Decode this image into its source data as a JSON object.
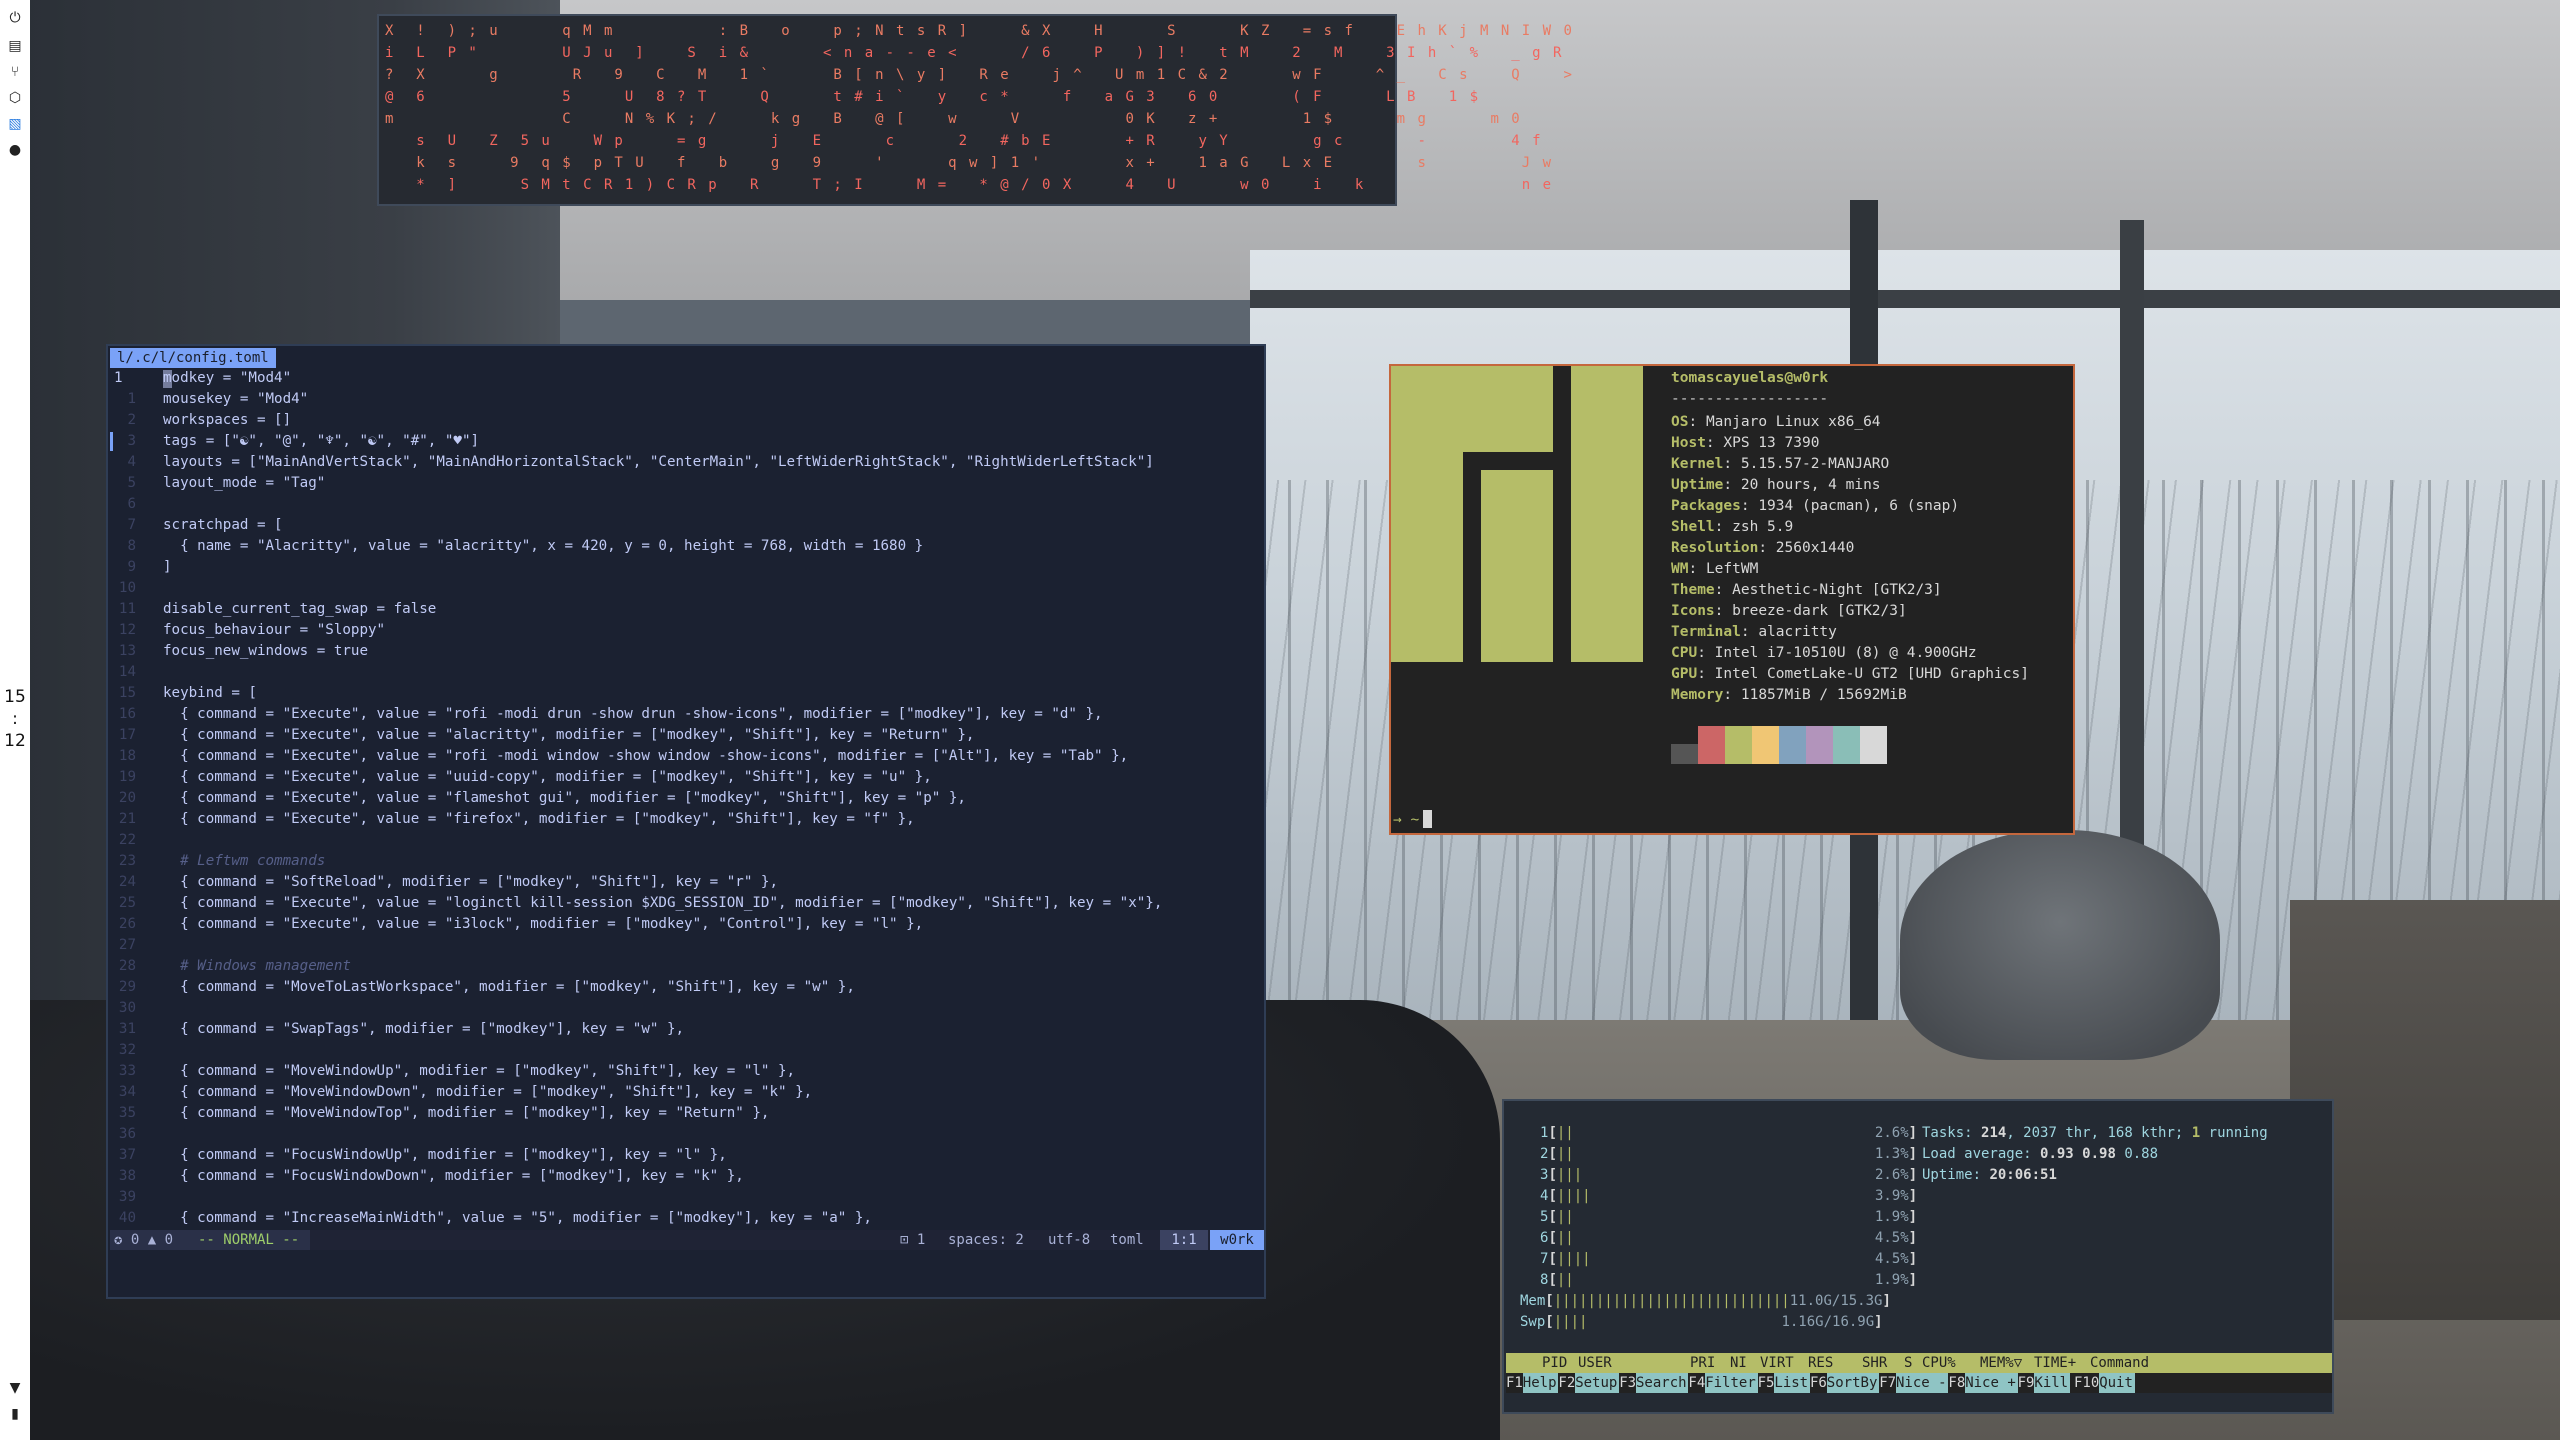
{
  "sidebar": {
    "clock_hour": "15",
    "clock_sep": ":",
    "clock_min": "12"
  },
  "matrix": {
    "lines": [
      "X  !  ) ; u      q M m          : B   o    p ; N t s R ]     & X    H      S      K Z   = s f    E h K j M N I W 0",
      "i  L  P \"        U J u  ]    S  i &       < n a - - e <      / 6    P   ) ] !   t M    2   M    3 I h ` %   _ g R",
      "?  X      g       R   9   C   M   1 `      B [ n \\ y ]   R e    j ^   U m 1 C & 2      w F     ^ _   C s    Q    >",
      "@  6             5     U  8 ? T     Q      t # i `   y   c *     f   a G 3   6 0       ( F      L B   1 $",
      "m                C     N % K ; /     k g   B   @ [    w     V          0 K   z +        1 $      m g      m 0",
      "   s  U   Z  5 u    W p     = g      j   E      c      2   # b E       + R    y Y        g c       -        4 f",
      "   k  s     9  q $  p T U   f   b    g   9     '      q w ] 1 '        x +    1 a G   L x E        s         J w",
      "   *  ]      S M t C R 1 ) C R p   R     T ; I     M =   * @ / 0 X     4   U      w 0    i   k               n e"
    ]
  },
  "editor": {
    "tab_label": "l/.c/l/config.toml",
    "lines": [
      {
        "num": "1",
        "text": "modkey = \"Mod4\"",
        "current": true
      },
      {
        "num": "1",
        "text": "mousekey = \"Mod4\""
      },
      {
        "num": "2",
        "text": "workspaces = []"
      },
      {
        "num": "3",
        "text": "tags = [\"☯\", \"@\", \"♆\", \"☯\", \"#\", \"♥\"]"
      },
      {
        "num": "4",
        "text": "layouts = [\"MainAndVertStack\", \"MainAndHorizontalStack\", \"CenterMain\", \"LeftWiderRightStack\", \"RightWiderLeftStack\"]"
      },
      {
        "num": "5",
        "text": "layout_mode = \"Tag\""
      },
      {
        "num": "6",
        "text": ""
      },
      {
        "num": "7",
        "text": "scratchpad = ["
      },
      {
        "num": "8",
        "text": "  { name = \"Alacritty\", value = \"alacritty\", x = 420, y = 0, height = 768, width = 1680 }"
      },
      {
        "num": "9",
        "text": "]"
      },
      {
        "num": "10",
        "text": ""
      },
      {
        "num": "11",
        "text": "disable_current_tag_swap = false"
      },
      {
        "num": "12",
        "text": "focus_behaviour = \"Sloppy\""
      },
      {
        "num": "13",
        "text": "focus_new_windows = true"
      },
      {
        "num": "14",
        "text": ""
      },
      {
        "num": "15",
        "text": "keybind = ["
      },
      {
        "num": "16",
        "text": "  { command = \"Execute\", value = \"rofi -modi drun -show drun -show-icons\", modifier = [\"modkey\"], key = \"d\" },"
      },
      {
        "num": "17",
        "text": "  { command = \"Execute\", value = \"alacritty\", modifier = [\"modkey\", \"Shift\"], key = \"Return\" },"
      },
      {
        "num": "18",
        "text": "  { command = \"Execute\", value = \"rofi -modi window -show window -show-icons\", modifier = [\"Alt\"], key = \"Tab\" },"
      },
      {
        "num": "19",
        "text": "  { command = \"Execute\", value = \"uuid-copy\", modifier = [\"modkey\", \"Shift\"], key = \"u\" },"
      },
      {
        "num": "20",
        "text": "  { command = \"Execute\", value = \"flameshot gui\", modifier = [\"modkey\", \"Shift\"], key = \"p\" },"
      },
      {
        "num": "21",
        "text": "  { command = \"Execute\", value = \"firefox\", modifier = [\"modkey\", \"Shift\"], key = \"f\" },"
      },
      {
        "num": "22",
        "text": ""
      },
      {
        "num": "23",
        "text": "  # Leftwm commands",
        "comment": true
      },
      {
        "num": "24",
        "text": "  { command = \"SoftReload\", modifier = [\"modkey\", \"Shift\"], key = \"r\" },"
      },
      {
        "num": "25",
        "text": "  { command = \"Execute\", value = \"loginctl kill-session $XDG_SESSION_ID\", modifier = [\"modkey\", \"Shift\"], key = \"x\"},"
      },
      {
        "num": "26",
        "text": "  { command = \"Execute\", value = \"i3lock\", modifier = [\"modkey\", \"Control\"], key = \"l\" },"
      },
      {
        "num": "27",
        "text": ""
      },
      {
        "num": "28",
        "text": "  # Windows management",
        "comment": true
      },
      {
        "num": "29",
        "text": "  { command = \"MoveToLastWorkspace\", modifier = [\"modkey\", \"Shift\"], key = \"w\" },"
      },
      {
        "num": "30",
        "text": ""
      },
      {
        "num": "31",
        "text": "  { command = \"SwapTags\", modifier = [\"modkey\"], key = \"w\" },"
      },
      {
        "num": "32",
        "text": ""
      },
      {
        "num": "33",
        "text": "  { command = \"MoveWindowUp\", modifier = [\"modkey\", \"Shift\"], key = \"l\" },"
      },
      {
        "num": "34",
        "text": "  { command = \"MoveWindowDown\", modifier = [\"modkey\", \"Shift\"], key = \"k\" },"
      },
      {
        "num": "35",
        "text": "  { command = \"MoveWindowTop\", modifier = [\"modkey\"], key = \"Return\" },"
      },
      {
        "num": "36",
        "text": ""
      },
      {
        "num": "37",
        "text": "  { command = \"FocusWindowUp\", modifier = [\"modkey\"], key = \"l\" },"
      },
      {
        "num": "38",
        "text": "  { command = \"FocusWindowDown\", modifier = [\"modkey\"], key = \"k\" },"
      },
      {
        "num": "39",
        "text": ""
      },
      {
        "num": "40",
        "text": "  { command = \"IncreaseMainWidth\", value = \"5\", modifier = [\"modkey\"], key = \"a\" },"
      }
    ],
    "status": {
      "diagnostics": "✪ 0 ▲ 0",
      "mode": "-- NORMAL --",
      "buffer": "⊡ 1",
      "spaces": "spaces: 2",
      "encoding": "utf-8",
      "filetype": "toml",
      "position": "1:1",
      "host": "w0rk"
    }
  },
  "neofetch": {
    "user_host": "tomascayuelas@w0rk",
    "separator": "------------------",
    "rows": [
      {
        "key": "OS",
        "value": "Manjaro Linux x86_64"
      },
      {
        "key": "Host",
        "value": "XPS 13 7390"
      },
      {
        "key": "Kernel",
        "value": "5.15.57-2-MANJARO"
      },
      {
        "key": "Uptime",
        "value": "20 hours, 4 mins"
      },
      {
        "key": "Packages",
        "value": "1934 (pacman), 6 (snap)"
      },
      {
        "key": "Shell",
        "value": "zsh 5.9"
      },
      {
        "key": "Resolution",
        "value": "2560x1440"
      },
      {
        "key": "WM",
        "value": "LeftWM"
      },
      {
        "key": "Theme",
        "value": "Aesthetic-Night [GTK2/3]"
      },
      {
        "key": "Icons",
        "value": "breeze-dark [GTK2/3]"
      },
      {
        "key": "Terminal",
        "value": "alacritty"
      },
      {
        "key": "CPU",
        "value": "Intel i7-10510U (8) @ 4.900GHz"
      },
      {
        "key": "GPU",
        "value": "Intel CometLake-U GT2 [UHD Graphics]"
      },
      {
        "key": "Memory",
        "value": "11857MiB / 15692MiB"
      }
    ],
    "palette": [
      "#555555",
      "#cc6666",
      "#b5bd68",
      "#f0c674",
      "#81a2be",
      "#b294bb",
      "#8abeb7",
      "#d8d8d8"
    ],
    "prompt": "→  ~"
  },
  "htop": {
    "cpus": [
      {
        "num": "1",
        "bars": "||",
        "pct": "2.6%"
      },
      {
        "num": "2",
        "bars": "||",
        "pct": "1.3%"
      },
      {
        "num": "3",
        "bars": "|||",
        "pct": "2.6%"
      },
      {
        "num": "4",
        "bars": "||||",
        "pct": "3.9%"
      },
      {
        "num": "5",
        "bars": "||",
        "pct": "1.9%"
      },
      {
        "num": "6",
        "bars": "||",
        "pct": "4.5%"
      },
      {
        "num": "7",
        "bars": "||||",
        "pct": "4.5%"
      },
      {
        "num": "8",
        "bars": "||",
        "pct": "1.9%"
      }
    ],
    "mem": {
      "label": "Mem",
      "bars": "||||||||||||||||||||||||||||",
      "value": "11.0G/15.3G"
    },
    "swp": {
      "label": "Swp",
      "bars": "||||",
      "value": "1.16G/16.9G"
    },
    "tasks_label": "Tasks:",
    "tasks_count": "214",
    "tasks_thr": "2037 thr, 168 kthr;",
    "tasks_running": "1",
    "tasks_running_label": "running",
    "load_label": "Load average:",
    "load_1": "0.93",
    "load_5": "0.98",
    "load_15": "0.88",
    "uptime_label": "Uptime:",
    "uptime": "20:06:51",
    "columns": [
      "PID",
      "USER",
      "PRI",
      "NI",
      "VIRT",
      "RES",
      "SHR",
      "S",
      "CPU%",
      "MEM%▽",
      "TIME+",
      "Command"
    ],
    "fkeys": [
      {
        "key": "F1",
        "label": "Help"
      },
      {
        "key": "F2",
        "label": "Setup"
      },
      {
        "key": "F3",
        "label": "Search"
      },
      {
        "key": "F4",
        "label": "Filter"
      },
      {
        "key": "F5",
        "label": "List"
      },
      {
        "key": "F6",
        "label": "SortBy"
      },
      {
        "key": "F7",
        "label": "Nice -"
      },
      {
        "key": "F8",
        "label": "Nice +"
      },
      {
        "key": "F9",
        "label": "Kill"
      },
      {
        "key": "F10",
        "label": "Quit"
      }
    ]
  }
}
